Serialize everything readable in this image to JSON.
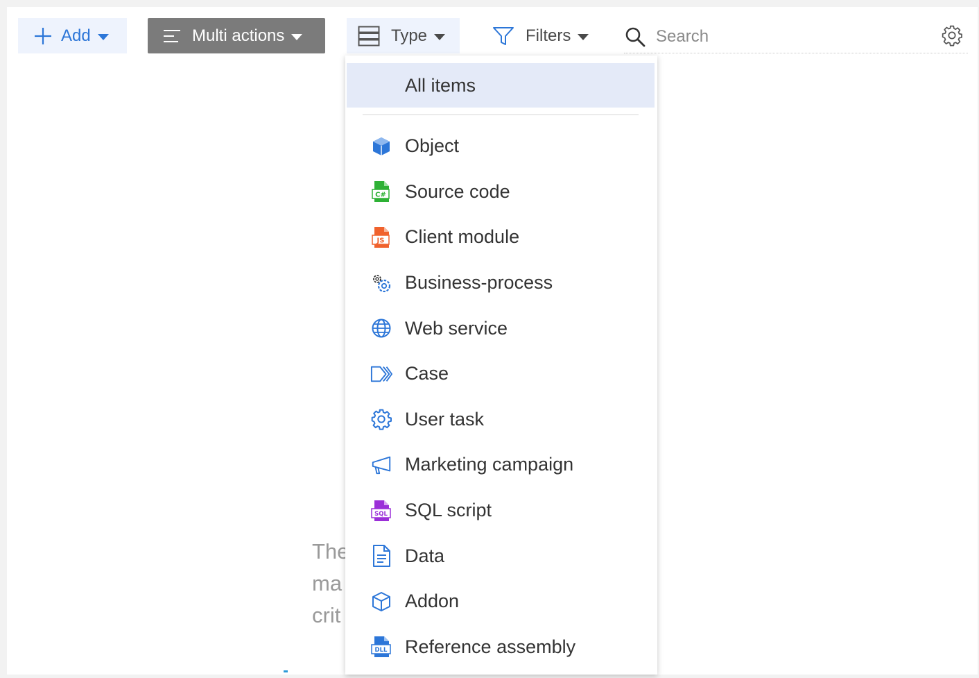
{
  "toolbar": {
    "add_label": "Add",
    "multi_actions_label": "Multi actions",
    "type_label": "Type",
    "filters_label": "Filters",
    "search_placeholder": "Search"
  },
  "type_menu": {
    "all_items_label": "All items",
    "items": [
      {
        "label": "Object",
        "icon": "cube-icon",
        "color": "#2c76d8"
      },
      {
        "label": "Source code",
        "icon": "csharp-file-icon",
        "color": "#2eb135"
      },
      {
        "label": "Client module",
        "icon": "js-file-icon",
        "color": "#f0622d"
      },
      {
        "label": "Business-process",
        "icon": "process-gears-icon",
        "color": "#2c76d8"
      },
      {
        "label": "Web service",
        "icon": "globe-icon",
        "color": "#2c76d8"
      },
      {
        "label": "Case",
        "icon": "case-chevrons-icon",
        "color": "#2c76d8"
      },
      {
        "label": "User task",
        "icon": "gear-icon",
        "color": "#2c76d8"
      },
      {
        "label": "Marketing campaign",
        "icon": "megaphone-icon",
        "color": "#2c76d8"
      },
      {
        "label": "SQL script",
        "icon": "sql-file-icon",
        "color": "#9b2fd8"
      },
      {
        "label": "Data",
        "icon": "document-icon",
        "color": "#2c76d8"
      },
      {
        "label": "Addon",
        "icon": "addon-cube-icon",
        "color": "#2c76d8"
      },
      {
        "label": "Reference assembly",
        "icon": "dll-file-icon",
        "color": "#2c76d8"
      }
    ]
  },
  "empty_state": {
    "line1": "The",
    "line2": "ma",
    "line3": "crit"
  },
  "colors": {
    "accent": "#2c76d8",
    "multi_actions_bg": "#7b7b7b",
    "selected_bg": "#e4eaf8"
  }
}
